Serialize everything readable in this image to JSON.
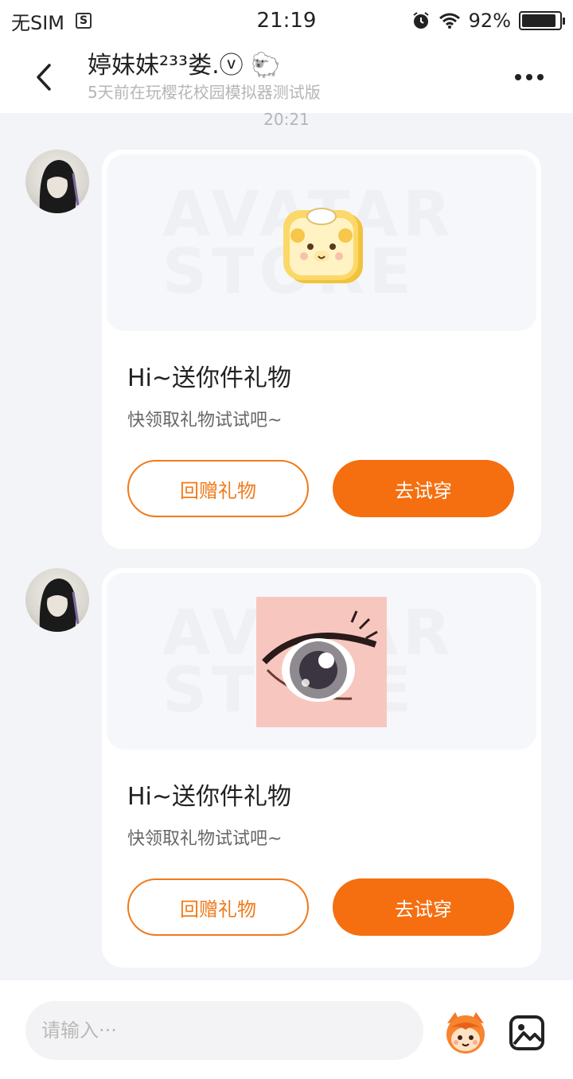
{
  "status_bar": {
    "carrier": "无SIM",
    "sim_icon_text": "S",
    "time": "21:19",
    "battery": "92%",
    "battery_level": 0.92
  },
  "header": {
    "title": "婷妹妹²³³娄.ⓥ 🐑",
    "subtitle": "5天前在玩樱花校园模拟器测试版"
  },
  "chat": {
    "time_label": "20:21",
    "messages": [
      {
        "title": "Hi~送你件礼物",
        "subtitle": "快领取礼物试试吧~",
        "return_gift_label": "回赠礼物",
        "try_on_label": "去试穿",
        "gift_icon": "bear-toast-icon",
        "watermark": "AVATAR STORE"
      },
      {
        "title": "Hi~送你件礼物",
        "subtitle": "快领取礼物试试吧~",
        "return_gift_label": "回赠礼物",
        "try_on_label": "去试穿",
        "gift_icon": "anime-eye-icon",
        "watermark": "AVATAR STORE"
      }
    ]
  },
  "input_bar": {
    "placeholder": "请输入···"
  },
  "colors": {
    "accent": "#f56e0f",
    "background": "#f3f4f8"
  }
}
